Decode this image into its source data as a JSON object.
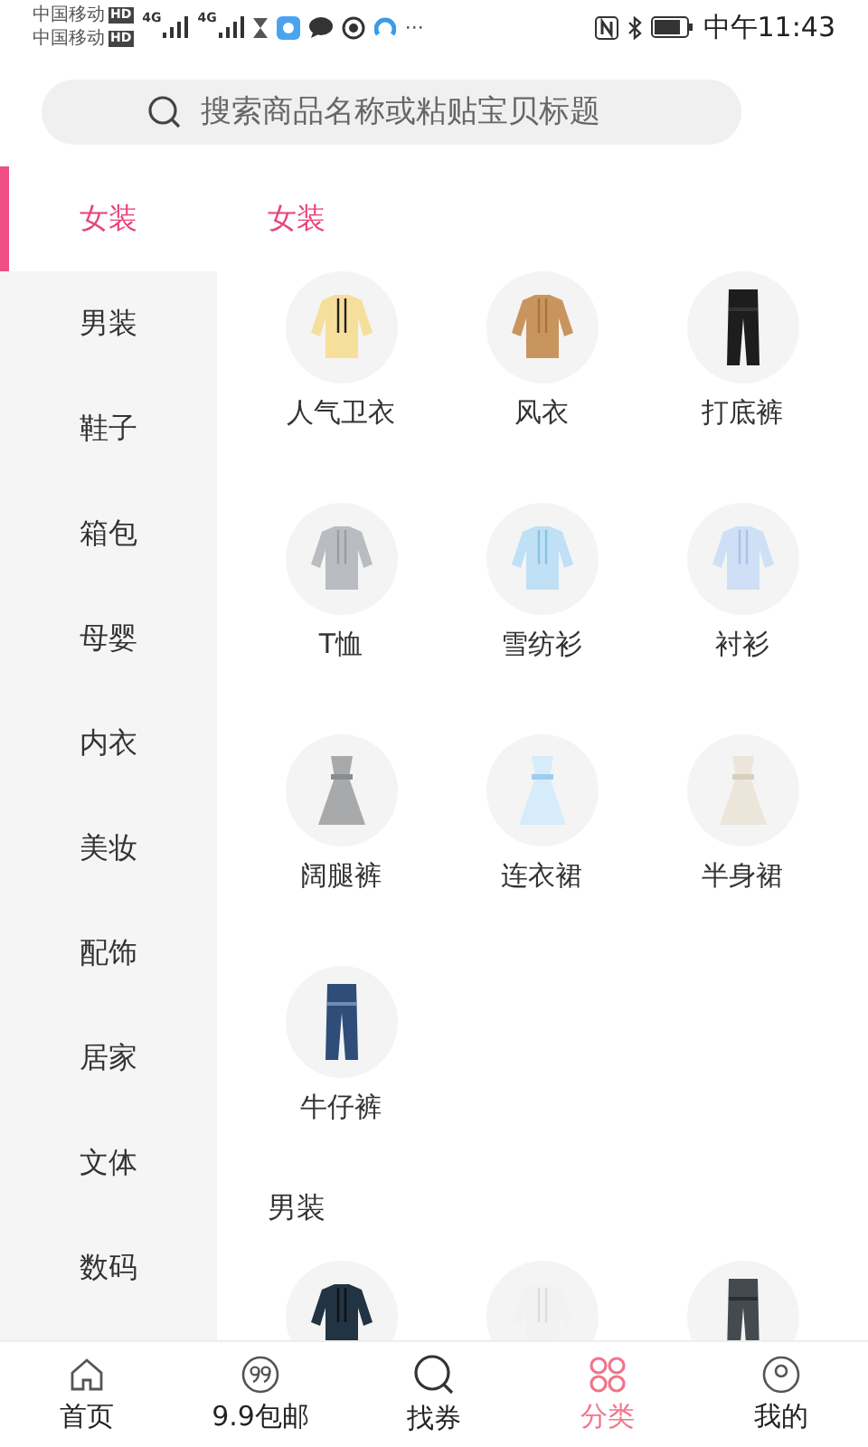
{
  "status_bar": {
    "carriers": [
      "中国移动",
      "中国移动"
    ],
    "hd_badges": [
      "HD",
      "HD"
    ],
    "network": [
      "4G",
      "4G"
    ],
    "more": "···",
    "time": "中午11:43"
  },
  "search": {
    "placeholder": "搜索商品名称或粘贴宝贝标题"
  },
  "sidebar": {
    "items": [
      {
        "label": "女装",
        "selected": true
      },
      {
        "label": "男装",
        "selected": false
      },
      {
        "label": "鞋子",
        "selected": false
      },
      {
        "label": "箱包",
        "selected": false
      },
      {
        "label": "母婴",
        "selected": false
      },
      {
        "label": "内衣",
        "selected": false
      },
      {
        "label": "美妆",
        "selected": false
      },
      {
        "label": "配饰",
        "selected": false
      },
      {
        "label": "居家",
        "selected": false
      },
      {
        "label": "文体",
        "selected": false
      },
      {
        "label": "数码",
        "selected": false
      }
    ]
  },
  "sections": [
    {
      "title": "女装",
      "items": [
        {
          "kind": "picture",
          "label": "人气卫衣"
        },
        {
          "kind": "picture",
          "label": "风衣"
        },
        {
          "kind": "picture",
          "label": "打底裤"
        },
        {
          "kind": "picture",
          "label": "T恤"
        },
        {
          "kind": "picture",
          "label": "雪纺衫"
        },
        {
          "kind": "picture",
          "label": "衬衫"
        },
        {
          "kind": "picture",
          "label": "阔腿裤"
        },
        {
          "kind": "picture",
          "label": "连衣裙"
        },
        {
          "kind": "picture",
          "label": "半身裙"
        },
        {
          "kind": "picture",
          "label": "牛仔裤"
        }
      ]
    },
    {
      "title": "男装"
    }
  ],
  "tab_bar": [
    {
      "label": "首页",
      "kind": "home",
      "selected": false
    },
    {
      "label": "9.9包邮",
      "kind": "badge",
      "selected": false
    },
    {
      "label": "找券",
      "kind": "search",
      "selected": false
    },
    {
      "label": "分类",
      "kind": "category",
      "selected": true
    },
    {
      "label": "我的",
      "kind": "profile",
      "selected": false
    }
  ]
}
